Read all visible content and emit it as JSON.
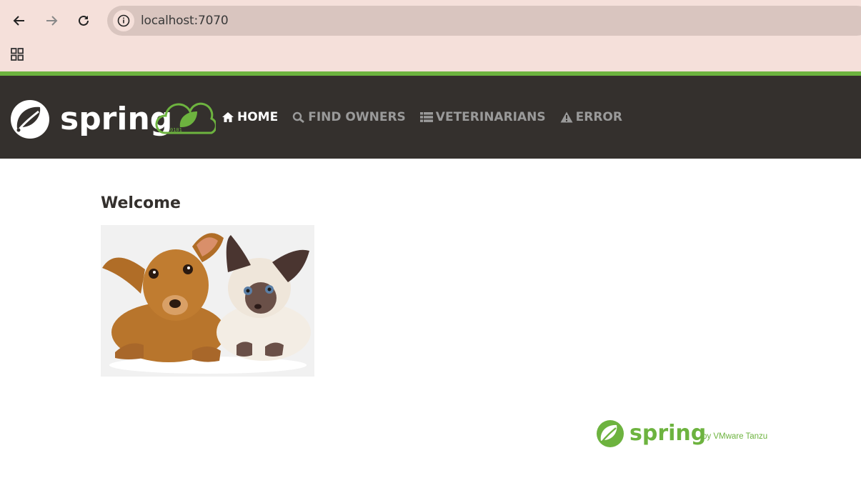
{
  "browser": {
    "url": "localhost:7070",
    "back_icon": "arrow-left-icon",
    "forward_icon": "arrow-right-icon",
    "reload_icon": "reload-icon",
    "site_info_icon": "info-icon",
    "apps_icon": "apps-grid-icon"
  },
  "navbar": {
    "brand_text": "spring",
    "accent_color": "#6db33f",
    "background_color": "#34302d",
    "items": [
      {
        "label": "HOME",
        "icon": "home-icon",
        "active": true
      },
      {
        "label": "FIND OWNERS",
        "icon": "search-icon",
        "active": false
      },
      {
        "label": "VETERINARIANS",
        "icon": "list-icon",
        "active": false
      },
      {
        "label": "ERROR",
        "icon": "warning-icon",
        "active": false
      }
    ]
  },
  "main": {
    "title": "Welcome"
  },
  "footer": {
    "brand_text": "spring",
    "tagline": "by VMware Tanzu"
  }
}
